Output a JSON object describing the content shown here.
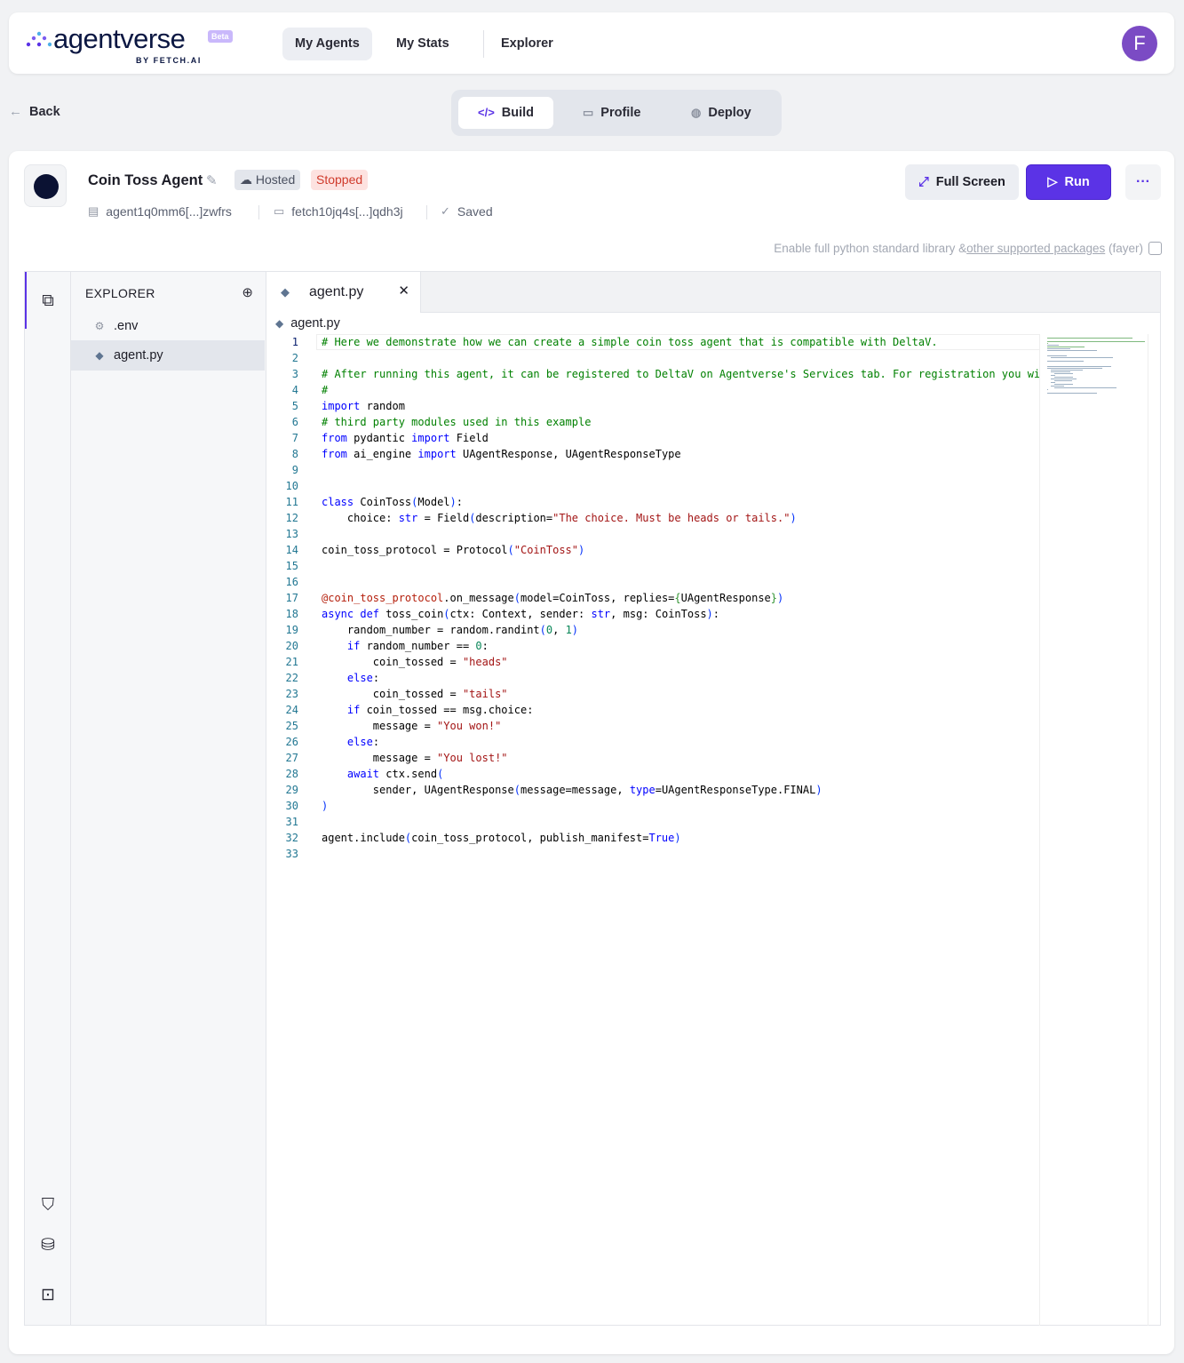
{
  "header": {
    "logo_text": "agentverse",
    "logo_badge": "Beta",
    "logo_sub": "BY FETCH.AI",
    "nav": [
      {
        "label": "My Agents",
        "active": true
      },
      {
        "label": "My Stats",
        "active": false
      },
      {
        "label": "Explorer",
        "active": false
      }
    ],
    "avatar_initial": "F"
  },
  "back_label": "Back",
  "mode_tabs": [
    {
      "label": "Build",
      "icon": "code-icon",
      "active": true
    },
    {
      "label": "Profile",
      "icon": "chart-icon",
      "active": false
    },
    {
      "label": "Deploy",
      "icon": "globe-icon",
      "active": false
    }
  ],
  "agent": {
    "name": "Coin Toss Agent",
    "hosted_label": "Hosted",
    "status": "Stopped",
    "address": "agent1q0mm6[...]zwfrs",
    "wallet": "fetch10jq4s[...]qdh3j",
    "saved_label": "Saved"
  },
  "actions": {
    "fullscreen_label": "Full Screen",
    "run_label": "Run",
    "more_label": "···"
  },
  "enable_packages": {
    "text_before": "Enable full python standard library &",
    "link": "other supported packages",
    "text_after": " (fayer)",
    "checked": false
  },
  "explorer": {
    "title": "EXPLORER",
    "files": [
      {
        "name": ".env",
        "icon": "gears-icon",
        "selected": false
      },
      {
        "name": "agent.py",
        "icon": "python-icon",
        "selected": true
      }
    ]
  },
  "editor": {
    "tab_label": "agent.py",
    "breadcrumb": "agent.py",
    "current_line": 1,
    "lines": [
      "# Here we demonstrate how we can create a simple coin toss agent that is compatible with DeltaV.",
      "",
      "# After running this agent, it can be registered to DeltaV on Agentverse's Services tab. For registration you wi",
      "#",
      "import random",
      "# third party modules used in this example",
      "from pydantic import Field",
      "from ai_engine import UAgentResponse, UAgentResponseType",
      "",
      "",
      "class CoinToss(Model):",
      "    choice: str = Field(description=\"The choice. Must be heads or tails.\")",
      "",
      "coin_toss_protocol = Protocol(\"CoinToss\")",
      "",
      "",
      "@coin_toss_protocol.on_message(model=CoinToss, replies={UAgentResponse})",
      "async def toss_coin(ctx: Context, sender: str, msg: CoinToss):",
      "    random_number = random.randint(0, 1)",
      "    if random_number == 0:",
      "        coin_tossed = \"heads\"",
      "    else:",
      "        coin_tossed = \"tails\"",
      "    if coin_tossed == msg.choice:",
      "        message = \"You won!\"",
      "    else:",
      "        message = \"You lost!\"",
      "    await ctx.send(",
      "        sender, UAgentResponse(message=message, type=UAgentResponseType.FINAL)",
      ")",
      "",
      "agent.include(coin_toss_protocol, publish_manifest=True)",
      ""
    ]
  }
}
